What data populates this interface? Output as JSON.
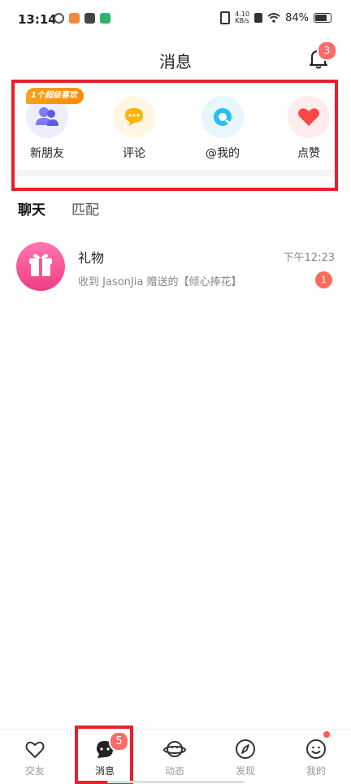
{
  "status_bar": {
    "time": "13:14",
    "speed_value": "4.10",
    "speed_unit": "KB/s",
    "battery": "84%"
  },
  "header": {
    "title": "消息",
    "bell_badge": "3"
  },
  "shortcuts": [
    {
      "label": "新朋友",
      "icon": "friends-icon",
      "bg": "#efeefe",
      "color": "#7b7cf6",
      "tag": "1个超级喜欢"
    },
    {
      "label": "评论",
      "icon": "comment-icon",
      "bg": "#fff6e3",
      "color": "#ffb400"
    },
    {
      "label": "@我的",
      "icon": "at-icon",
      "bg": "#e6f7fd",
      "color": "#25c1ef"
    },
    {
      "label": "点赞",
      "icon": "heart-icon",
      "bg": "#ffecec",
      "color": "#ff4747"
    }
  ],
  "tabs": [
    "聊天",
    "匹配"
  ],
  "chats": [
    {
      "name": "礼物",
      "preview": "收到 JasonJia 赠送的【倾心捧花】",
      "time": "下午12:23",
      "unread": "1"
    }
  ],
  "tabbar": {
    "items": [
      {
        "label": "交友",
        "icon": "heart-outline-icon"
      },
      {
        "label": "消息",
        "icon": "chat-bubble-icon",
        "active": true,
        "badge": "5"
      },
      {
        "label": "动态",
        "icon": "planet-icon"
      },
      {
        "label": "发现",
        "icon": "compass-icon"
      },
      {
        "label": "我的",
        "icon": "smiley-icon",
        "dot": true
      }
    ]
  },
  "colors": {
    "accent_red": "#e8202a",
    "badge_red": "#ff6b6b",
    "gift_pink": "#f03c84"
  }
}
